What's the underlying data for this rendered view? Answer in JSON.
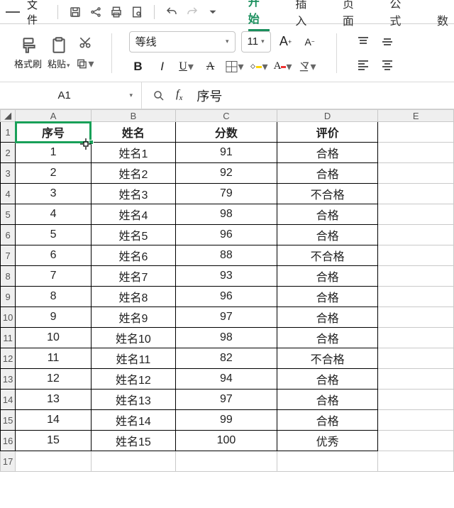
{
  "menubar": {
    "file": "文件",
    "tabs": [
      "开始",
      "插入",
      "页面",
      "公式",
      "数"
    ]
  },
  "toolbar": {
    "format_painter": "格式刷",
    "paste": "粘贴",
    "font_name": "等线",
    "font_size": "11"
  },
  "namebox": {
    "ref": "A1"
  },
  "formula": {
    "value": "序号"
  },
  "columns": [
    "A",
    "B",
    "C",
    "D",
    "E"
  ],
  "headers": {
    "A": "序号",
    "B": "姓名",
    "C": "分数",
    "D": "评价"
  },
  "rows": [
    {
      "A": "1",
      "B": "姓名1",
      "C": "91",
      "D": "合格"
    },
    {
      "A": "2",
      "B": "姓名2",
      "C": "92",
      "D": "合格"
    },
    {
      "A": "3",
      "B": "姓名3",
      "C": "79",
      "D": "不合格"
    },
    {
      "A": "4",
      "B": "姓名4",
      "C": "98",
      "D": "合格"
    },
    {
      "A": "5",
      "B": "姓名5",
      "C": "96",
      "D": "合格"
    },
    {
      "A": "6",
      "B": "姓名6",
      "C": "88",
      "D": "不合格"
    },
    {
      "A": "7",
      "B": "姓名7",
      "C": "93",
      "D": "合格"
    },
    {
      "A": "8",
      "B": "姓名8",
      "C": "96",
      "D": "合格"
    },
    {
      "A": "9",
      "B": "姓名9",
      "C": "97",
      "D": "合格"
    },
    {
      "A": "10",
      "B": "姓名10",
      "C": "98",
      "D": "合格"
    },
    {
      "A": "11",
      "B": "姓名11",
      "C": "82",
      "D": "不合格"
    },
    {
      "A": "12",
      "B": "姓名12",
      "C": "94",
      "D": "合格"
    },
    {
      "A": "13",
      "B": "姓名13",
      "C": "97",
      "D": "合格"
    },
    {
      "A": "14",
      "B": "姓名14",
      "C": "99",
      "D": "合格"
    },
    {
      "A": "15",
      "B": "姓名15",
      "C": "100",
      "D": "优秀"
    }
  ],
  "chart_data": {
    "type": "table",
    "columns": [
      "序号",
      "姓名",
      "分数",
      "评价"
    ],
    "data": [
      [
        1,
        "姓名1",
        91,
        "合格"
      ],
      [
        2,
        "姓名2",
        92,
        "合格"
      ],
      [
        3,
        "姓名3",
        79,
        "不合格"
      ],
      [
        4,
        "姓名4",
        98,
        "合格"
      ],
      [
        5,
        "姓名5",
        96,
        "合格"
      ],
      [
        6,
        "姓名6",
        88,
        "不合格"
      ],
      [
        7,
        "姓名7",
        93,
        "合格"
      ],
      [
        8,
        "姓名8",
        96,
        "合格"
      ],
      [
        9,
        "姓名9",
        97,
        "合格"
      ],
      [
        10,
        "姓名10",
        98,
        "合格"
      ],
      [
        11,
        "姓名11",
        82,
        "不合格"
      ],
      [
        12,
        "姓名12",
        94,
        "合格"
      ],
      [
        13,
        "姓名13",
        97,
        "合格"
      ],
      [
        14,
        "姓名14",
        99,
        "合格"
      ],
      [
        15,
        "姓名15",
        100,
        "优秀"
      ]
    ]
  }
}
